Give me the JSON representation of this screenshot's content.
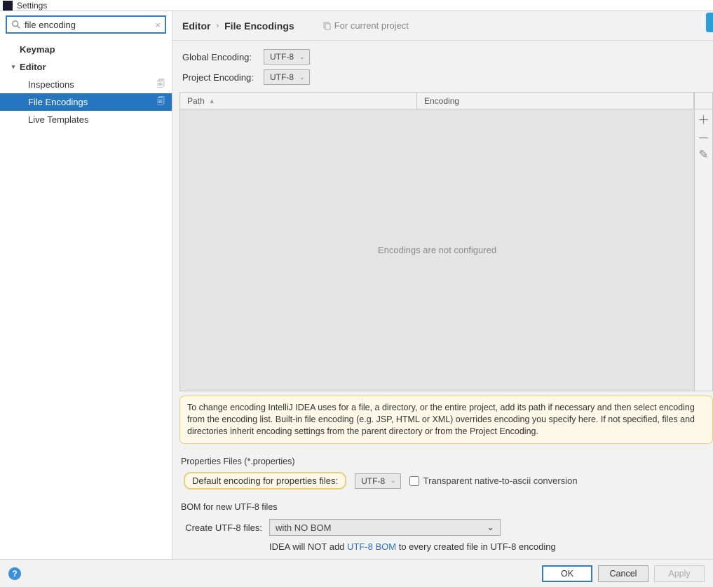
{
  "window": {
    "title": "Settings"
  },
  "search": {
    "value": "file encoding",
    "clear_glyph": "×"
  },
  "tree": {
    "keymap": "Keymap",
    "editor": "Editor",
    "inspections": "Inspections",
    "file_encodings": "File Encodings",
    "live_templates": "Live Templates"
  },
  "breadcrumb": {
    "parent": "Editor",
    "current": "File Encodings",
    "project_tag": "For current project"
  },
  "encodings": {
    "global_label": "Global Encoding:",
    "global_value": "UTF-8",
    "project_label": "Project Encoding:",
    "project_value": "UTF-8"
  },
  "table": {
    "col_path": "Path",
    "col_encoding": "Encoding",
    "empty_text": "Encodings are not configured"
  },
  "info_text": "To change encoding IntelliJ IDEA uses for a file, a directory, or the entire project, add its path if necessary and then select encoding from the encoding list. Built-in file encoding (e.g. JSP, HTML or XML) overrides encoding you specify here. If not specified, files and directories inherit encoding settings from the parent directory or from the Project Encoding.",
  "properties": {
    "section_label": "Properties Files (*.properties)",
    "default_label": "Default encoding for properties files:",
    "default_value": "UTF-8",
    "transparent_label": "Transparent native-to-ascii conversion"
  },
  "bom": {
    "section_label": "BOM for new UTF-8 files",
    "create_label": "Create UTF-8 files:",
    "create_value": "with NO BOM",
    "hint_prefix": "IDEA will NOT add ",
    "hint_link": "UTF-8 BOM",
    "hint_suffix": " to every created file in UTF-8 encoding"
  },
  "footer": {
    "ok": "OK",
    "cancel": "Cancel",
    "apply": "Apply"
  }
}
